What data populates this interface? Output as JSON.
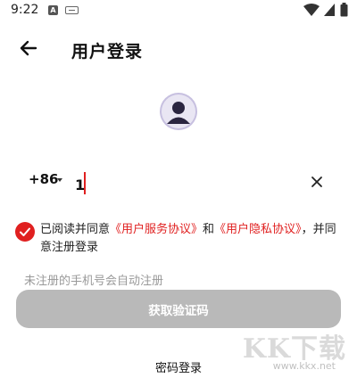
{
  "status_bar": {
    "time": "9:22",
    "a_icon": "A"
  },
  "header": {
    "title": "用户登录"
  },
  "phone": {
    "country_code": "+86",
    "value": "1"
  },
  "agreement": {
    "prefix": "已阅读并同意",
    "link1": "《用户服务协议》",
    "middle": "和",
    "link2": "《用户隐私协议》",
    "suffix": "，并同意注册登录"
  },
  "hint": "未注册的手机号会自动注册",
  "buttons": {
    "get_code": "获取验证码",
    "password_login": "密码登录"
  },
  "watermark": {
    "logo": "KK下载",
    "url": "www.kkx.net"
  },
  "colors": {
    "accent": "#e02020",
    "button_disabled": "#b9b9b9",
    "avatar_bg": "#c7c0e0"
  }
}
